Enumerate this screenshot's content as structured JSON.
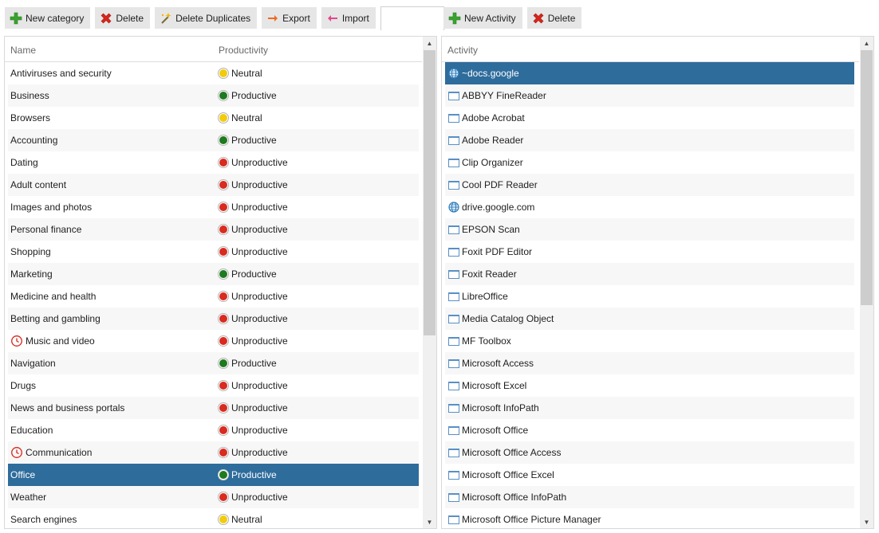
{
  "toolbar_left": {
    "new_category": "New category",
    "delete": "Delete",
    "delete_duplicates": "Delete Duplicates",
    "export": "Export",
    "import": "Import",
    "filter_value": ""
  },
  "toolbar_right": {
    "new_activity": "New Activity",
    "delete": "Delete"
  },
  "categories": {
    "columns": {
      "name": "Name",
      "productivity": "Productivity"
    },
    "status_colors": {
      "Neutral": "#f2cc0c",
      "Productive": "#1f7a1f",
      "Unproductive": "#d92b1f"
    },
    "rows": [
      {
        "name": "Antiviruses and security",
        "productivity": "Neutral"
      },
      {
        "name": "Business",
        "productivity": "Productive"
      },
      {
        "name": "Browsers",
        "productivity": "Neutral"
      },
      {
        "name": "Accounting",
        "productivity": "Productive"
      },
      {
        "name": "Dating",
        "productivity": "Unproductive"
      },
      {
        "name": "Adult content",
        "productivity": "Unproductive"
      },
      {
        "name": "Images and photos",
        "productivity": "Unproductive"
      },
      {
        "name": "Personal finance",
        "productivity": "Unproductive"
      },
      {
        "name": "Shopping",
        "productivity": "Unproductive"
      },
      {
        "name": "Marketing",
        "productivity": "Productive"
      },
      {
        "name": "Medicine and health",
        "productivity": "Unproductive"
      },
      {
        "name": "Betting and gambling",
        "productivity": "Unproductive"
      },
      {
        "name": "Music and video",
        "productivity": "Unproductive",
        "icon": "clock-icon"
      },
      {
        "name": "Navigation",
        "productivity": "Productive"
      },
      {
        "name": "Drugs",
        "productivity": "Unproductive"
      },
      {
        "name": "News and business portals",
        "productivity": "Unproductive"
      },
      {
        "name": "Education",
        "productivity": "Unproductive"
      },
      {
        "name": "Communication",
        "productivity": "Unproductive",
        "icon": "clock-icon"
      },
      {
        "name": "Office",
        "productivity": "Productive",
        "selected": true
      },
      {
        "name": "Weather",
        "productivity": "Unproductive"
      },
      {
        "name": "Search engines",
        "productivity": "Neutral"
      }
    ]
  },
  "activities": {
    "column": "Activity",
    "rows": [
      {
        "name": "~docs.google",
        "icon": "globe-icon",
        "selected": true
      },
      {
        "name": "ABBYY FineReader",
        "icon": "window-icon"
      },
      {
        "name": "Adobe Acrobat",
        "icon": "window-icon"
      },
      {
        "name": "Adobe Reader",
        "icon": "window-icon"
      },
      {
        "name": "Clip Organizer",
        "icon": "window-icon"
      },
      {
        "name": "Cool PDF Reader",
        "icon": "window-icon"
      },
      {
        "name": "drive.google.com",
        "icon": "globe-icon"
      },
      {
        "name": "EPSON Scan",
        "icon": "window-icon"
      },
      {
        "name": "Foxit PDF Editor",
        "icon": "window-icon"
      },
      {
        "name": "Foxit Reader",
        "icon": "window-icon"
      },
      {
        "name": "LibreOffice",
        "icon": "window-icon"
      },
      {
        "name": "Media Catalog Object",
        "icon": "window-icon"
      },
      {
        "name": "MF Toolbox",
        "icon": "window-icon"
      },
      {
        "name": "Microsoft Access",
        "icon": "window-icon"
      },
      {
        "name": "Microsoft Excel",
        "icon": "window-icon"
      },
      {
        "name": "Microsoft InfoPath",
        "icon": "window-icon"
      },
      {
        "name": "Microsoft Office",
        "icon": "window-icon"
      },
      {
        "name": "Microsoft Office Access",
        "icon": "window-icon"
      },
      {
        "name": "Microsoft Office Excel",
        "icon": "window-icon"
      },
      {
        "name": "Microsoft Office InfoPath",
        "icon": "window-icon"
      },
      {
        "name": "Microsoft Office Picture Manager",
        "icon": "window-icon"
      }
    ]
  },
  "colors": {
    "selection": "#2e6c9c",
    "toolbar_button": "#e6e6e6"
  }
}
